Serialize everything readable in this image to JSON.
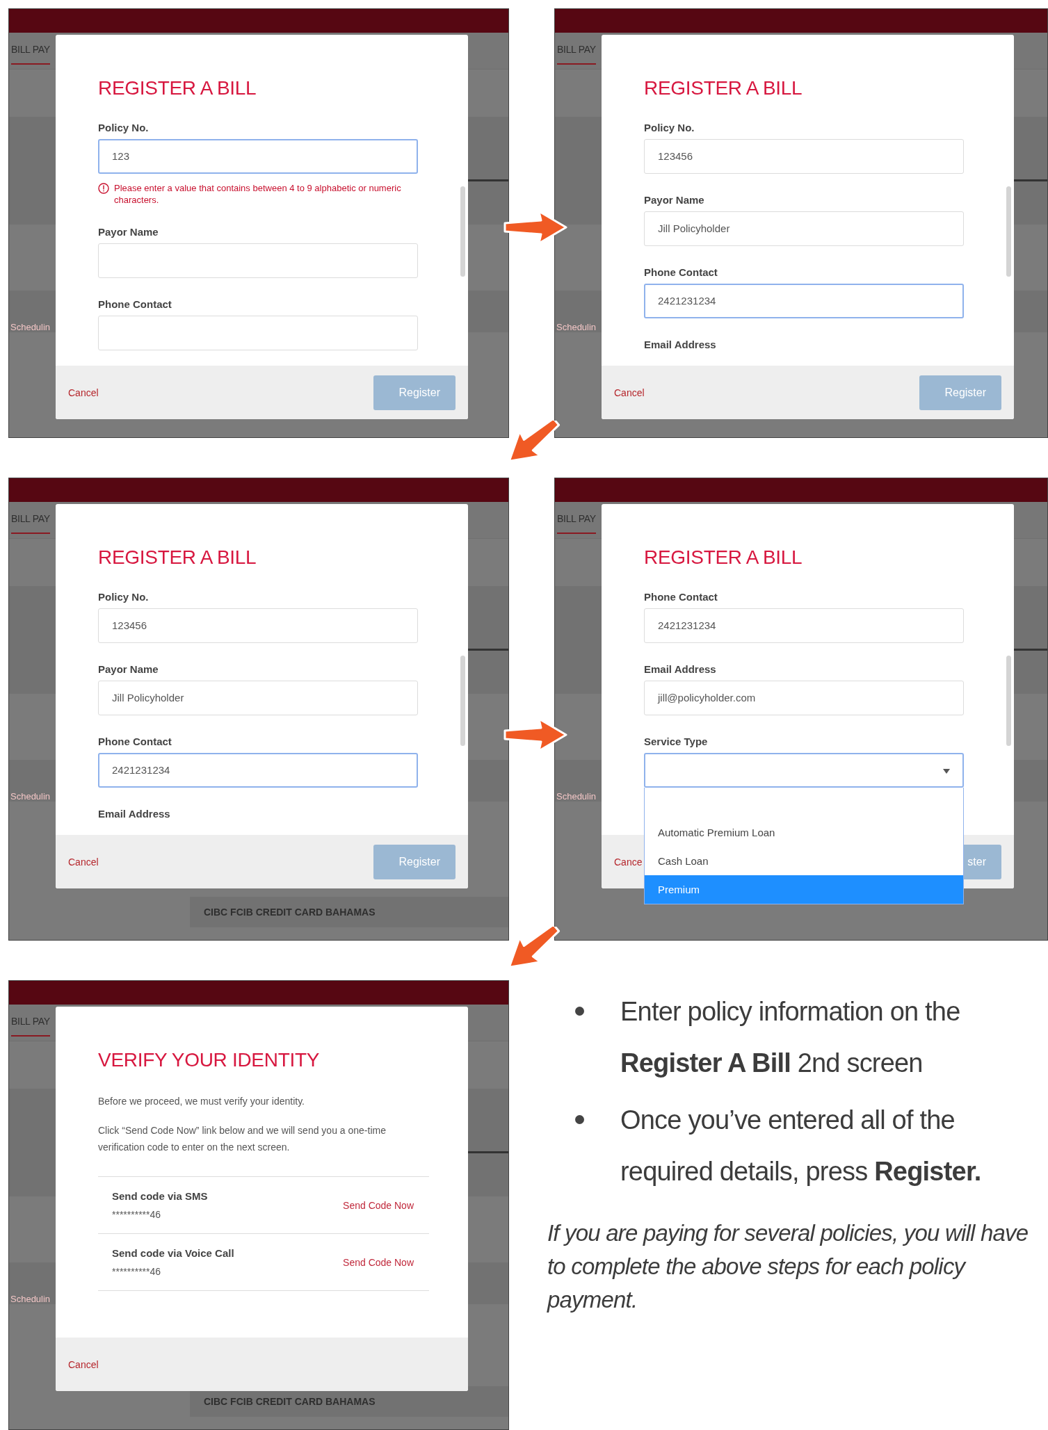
{
  "screens": [
    {
      "kind": "form",
      "background": {
        "tab": "BILL PAY",
        "side_text": "Schedulin"
      },
      "dialog": {
        "title": "REGISTER A BILL",
        "fields": [
          {
            "kind": "text",
            "label": "Policy No.",
            "value": "123",
            "focused": true,
            "error": "Please enter a value that contains between 4 to 9 alphabetic or numeric characters."
          },
          {
            "kind": "text",
            "label": "Payor Name",
            "focused": false
          },
          {
            "kind": "text",
            "label": "Phone Contact",
            "focused": false
          }
        ],
        "footer": {
          "cancel": "Cancel",
          "register": "Register"
        }
      }
    },
    {
      "kind": "form",
      "background": {
        "tab": "BILL PAY",
        "side_text": "Schedulin"
      },
      "dialog": {
        "title": "REGISTER A BILL",
        "fields": [
          {
            "kind": "text",
            "label": "Policy No.",
            "value": "123456",
            "focused": false
          },
          {
            "kind": "text",
            "label": "Payor Name",
            "value": "Jill Policyholder",
            "focused": false
          },
          {
            "kind": "text",
            "label": "Phone Contact",
            "value": "2421231234",
            "focused": true
          },
          {
            "kind": "label",
            "label": "Email Address"
          }
        ],
        "footer": {
          "cancel": "Cancel",
          "register": "Register"
        }
      }
    },
    {
      "kind": "form",
      "background": {
        "tab": "BILL PAY",
        "side_text": "Schedulin",
        "bottom_row": "CIBC FCIB CREDIT CARD BAHAMAS"
      },
      "dialog": {
        "title": "REGISTER A BILL",
        "fields": [
          {
            "kind": "text",
            "label": "Policy No.",
            "value": "123456",
            "focused": false
          },
          {
            "kind": "text",
            "label": "Payor Name",
            "value": "Jill Policyholder",
            "focused": false
          },
          {
            "kind": "text",
            "label": "Phone Contact",
            "value": "2421231234",
            "focused": true
          },
          {
            "kind": "label",
            "label": "Email Address"
          }
        ],
        "footer": {
          "cancel": "Cancel",
          "register": "Register"
        }
      }
    },
    {
      "kind": "form",
      "background": {
        "tab": "BILL PAY",
        "side_text": "Schedulin"
      },
      "dialog": {
        "title": "REGISTER A BILL",
        "fields": [
          {
            "kind": "text",
            "label": "Phone Contact",
            "value": "2421231234",
            "focused": false
          },
          {
            "kind": "text",
            "label": "Email Address",
            "value": "jill@policyholder.com",
            "focused": false
          },
          {
            "kind": "select",
            "label": "Service Type",
            "focused": true,
            "expanded": true,
            "options": [
              {
                "label": "Automatic Premium Loan",
                "selected": false
              },
              {
                "label": "Cash Loan",
                "selected": false
              },
              {
                "label": "Premium",
                "selected": true
              }
            ]
          }
        ],
        "footer": {
          "cancel": "Cance",
          "register": "ster"
        }
      }
    },
    {
      "kind": "verify",
      "background": {
        "tab": "BILL PAY",
        "side_text": "Schedulin",
        "bottom_row": "CIBC FCIB CREDIT CARD BAHAMAS"
      },
      "dialog": {
        "title": "VERIFY YOUR IDENTITY",
        "paragraphs": [
          "Before we proceed, we must verify your identity.",
          "Click “Send Code Now” link below and we will send you a one-time verification code to enter on the next screen."
        ],
        "methods": [
          {
            "title": "Send code via SMS",
            "masked": "**********46",
            "link": "Send Code Now"
          },
          {
            "title": "Send code via Voice Call",
            "masked": "**********46",
            "link": "Send Code Now"
          }
        ],
        "footer": {
          "cancel": "Cancel"
        }
      }
    }
  ],
  "notes": {
    "bullets": [
      "Enter policy information on the **Register A Bill** 2nd screen",
      "Once you’ve entered all of the required details, press **Register.**"
    ],
    "footnote": "If you are paying for several policies, you will have to complete the above steps for each policy payment."
  }
}
